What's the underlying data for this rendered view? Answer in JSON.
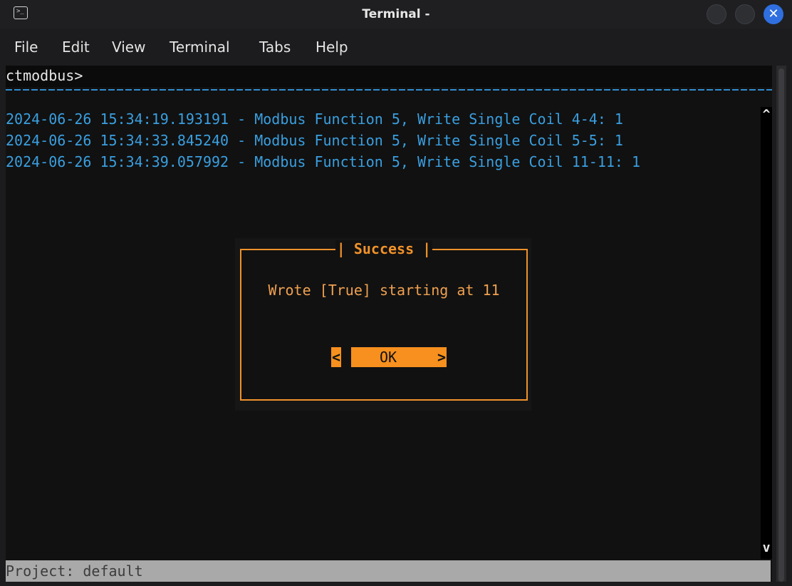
{
  "window": {
    "title": "Terminal -",
    "app_icon": "terminal-icon",
    "controls": [
      "minimize-icon",
      "maximize-icon",
      "close-icon"
    ],
    "close_glyph": "✕"
  },
  "menu": {
    "file": "File",
    "edit": "Edit",
    "view": "View",
    "terminal": "Terminal",
    "tabs": "Tabs",
    "help": "Help"
  },
  "terminal": {
    "prompt": "ctmodbus>",
    "log": [
      "2024-06-26 15:34:19.193191 - Modbus Function 5, Write Single Coil 4-4: 1",
      "2024-06-26 15:34:33.845240 - Modbus Function 5, Write Single Coil 5-5: 1",
      "2024-06-26 15:34:39.057992 - Modbus Function 5, Write Single Coil 11-11: 1"
    ],
    "scroll_up": "^",
    "scroll_down": "v",
    "status": "Project: default"
  },
  "dialog": {
    "title": "| Success |",
    "message": "Wrote [True] starting at 11",
    "ok_left": "<",
    "ok_label": "OK",
    "ok_right": ">"
  },
  "colors": {
    "log_text": "#3a9fe0",
    "dialog_accent": "#f0922a",
    "close_button": "#2f6fe0"
  }
}
